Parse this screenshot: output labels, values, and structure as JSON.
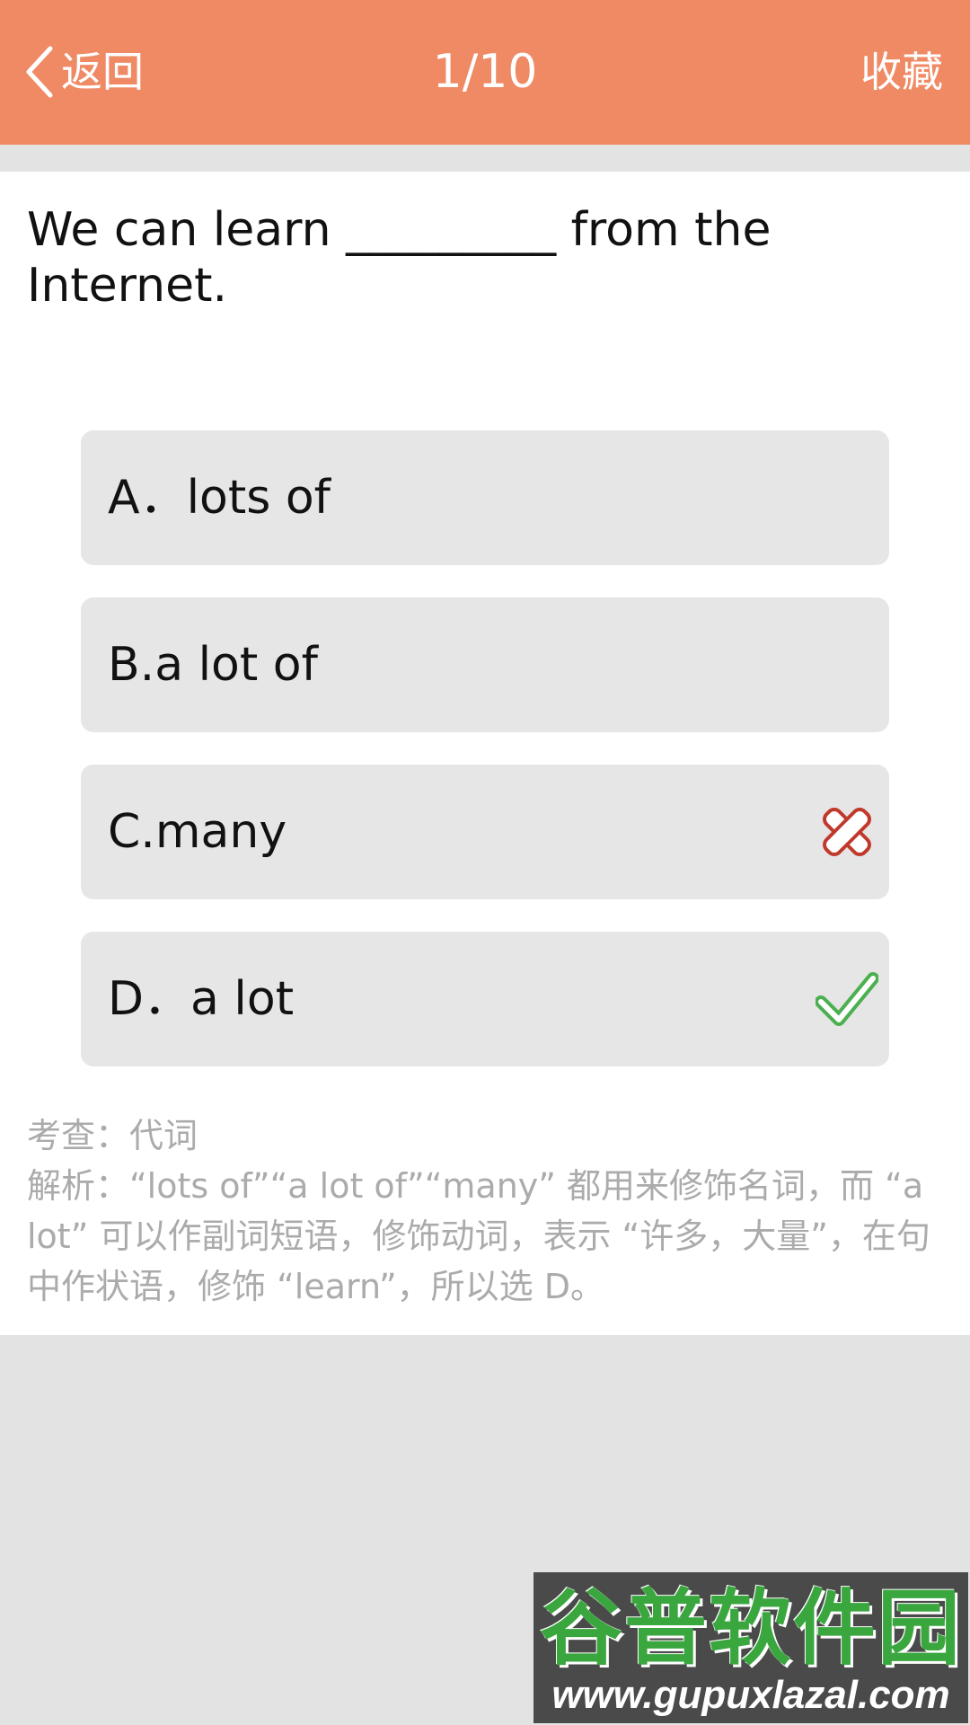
{
  "header": {
    "back_label": "返回",
    "progress": "1/10",
    "favorite_label": "收藏"
  },
  "question": {
    "text": "We can learn _________ from the Internet."
  },
  "options": [
    {
      "label": "A．lots of",
      "mark": ""
    },
    {
      "label": "B.a lot of",
      "mark": ""
    },
    {
      "label": "C.many",
      "mark": "wrong-icon"
    },
    {
      "label": "D．a lot",
      "mark": "correct-icon"
    }
  ],
  "analysis": {
    "topic": "考查：代词",
    "explanation": "解析：“lots of”“a lot of”“many” 都用来修饰名词，而 “a lot” 可以作副词短语，修饰动词，表示 “许多，大量”，在句中作状语，修饰 “learn”，所以选 D。"
  },
  "watermark": {
    "title": "谷普软件园",
    "url": "www.gupuxlazal.com"
  },
  "colors": {
    "header_bg": "#ef8a65",
    "wrong_mark": "#c0392b",
    "correct_mark": "#4caf50",
    "option_bg": "#e6e6e6",
    "analysis_text": "#ababab"
  }
}
